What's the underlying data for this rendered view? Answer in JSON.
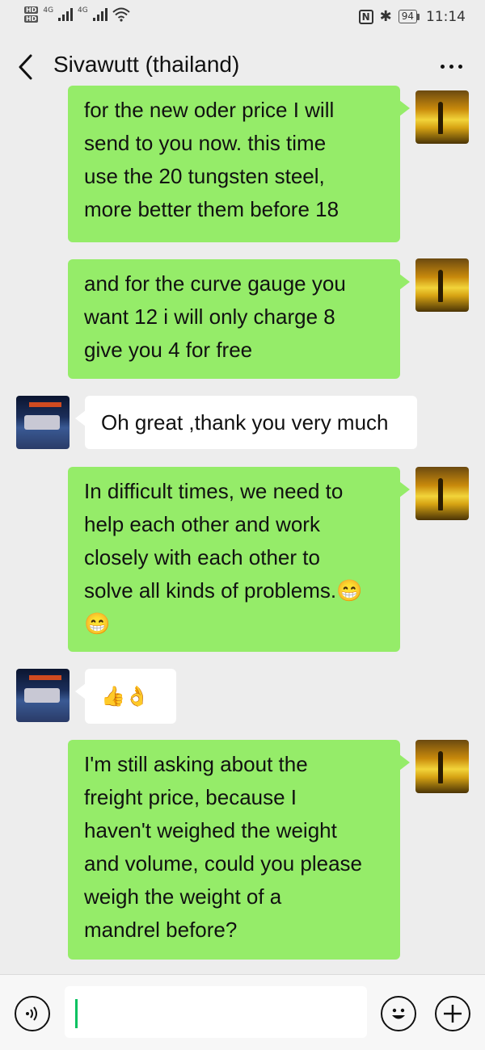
{
  "status_bar": {
    "hd1": "HD",
    "hd2": "HD",
    "net1": "4G",
    "net2": "4G",
    "battery": "94",
    "time": "11:14"
  },
  "header": {
    "contact_name": "Sivawutt        (thailand)"
  },
  "messages": [
    {
      "sender": "me",
      "text": "for the new oder price I will\nsend to you now. this time\nuse the 20 tungsten steel,\nmore better them before 18"
    },
    {
      "sender": "me",
      "text": "and for the curve gauge you\nwant 12 i will only charge 8\ngive you 4 for free"
    },
    {
      "sender": "contact",
      "text": "Oh great ,thank you very much"
    },
    {
      "sender": "me",
      "text": "In difficult times, we need to\nhelp each other and work\nclosely with each other to\nsolve all kinds of problems.😁\n😁"
    },
    {
      "sender": "contact",
      "text": "👍👌"
    },
    {
      "sender": "me",
      "text": "I'm still asking about the\nfreight price, because I\nhaven't weighed the weight\nand volume, could you please\nweigh the weight of a\nmandrel before?"
    }
  ],
  "input_bar": {
    "value": "",
    "icons": [
      "voice-icon",
      "emoji-icon",
      "plus-icon"
    ]
  },
  "colors": {
    "my_bubble": "#95ec69",
    "their_bubble": "#ffffff",
    "background": "#ededed",
    "caret": "#07c160"
  }
}
